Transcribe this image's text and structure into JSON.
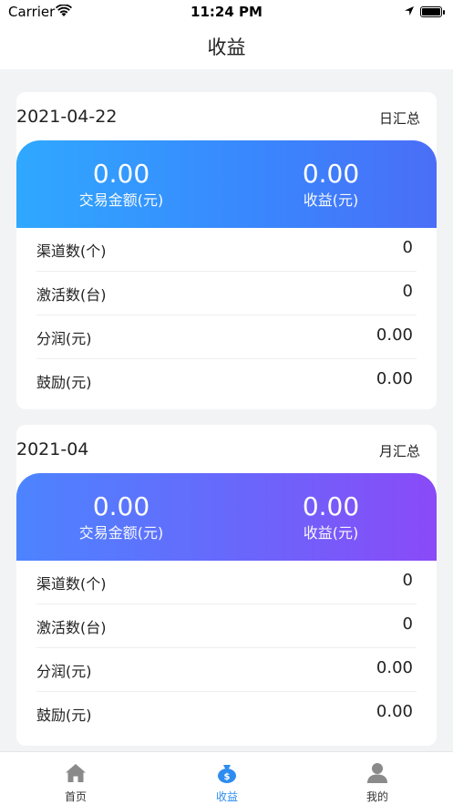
{
  "status_bar": {
    "carrier": "Carrier",
    "time": "11:24 PM"
  },
  "nav": {
    "title": "收益"
  },
  "daily": {
    "date": "2021-04-22",
    "summary_label": "日汇总",
    "transaction_amount": "0.00",
    "transaction_label": "交易金额(元)",
    "income": "0.00",
    "income_label": "收益(元)",
    "rows": [
      {
        "label": "渠道数(个)",
        "value": "0"
      },
      {
        "label": "激活数(台)",
        "value": "0"
      },
      {
        "label": "分润(元)",
        "value": "0.00"
      },
      {
        "label": "鼓励(元)",
        "value": "0.00"
      }
    ]
  },
  "monthly": {
    "date": "2021-04",
    "summary_label": "月汇总",
    "transaction_amount": "0.00",
    "transaction_label": "交易金额(元)",
    "income": "0.00",
    "income_label": "收益(元)",
    "rows": [
      {
        "label": "渠道数(个)",
        "value": "0"
      },
      {
        "label": "激活数(台)",
        "value": "0"
      },
      {
        "label": "分润(元)",
        "value": "0.00"
      },
      {
        "label": "鼓励(元)",
        "value": "0.00"
      }
    ]
  },
  "tab_bar": {
    "tabs": [
      {
        "label": "首页",
        "icon": "home-icon"
      },
      {
        "label": "收益",
        "icon": "money-bag-icon"
      },
      {
        "label": "我的",
        "icon": "user-icon"
      }
    ],
    "active_color": "#2d8cf0",
    "inactive_color": "#888888"
  }
}
